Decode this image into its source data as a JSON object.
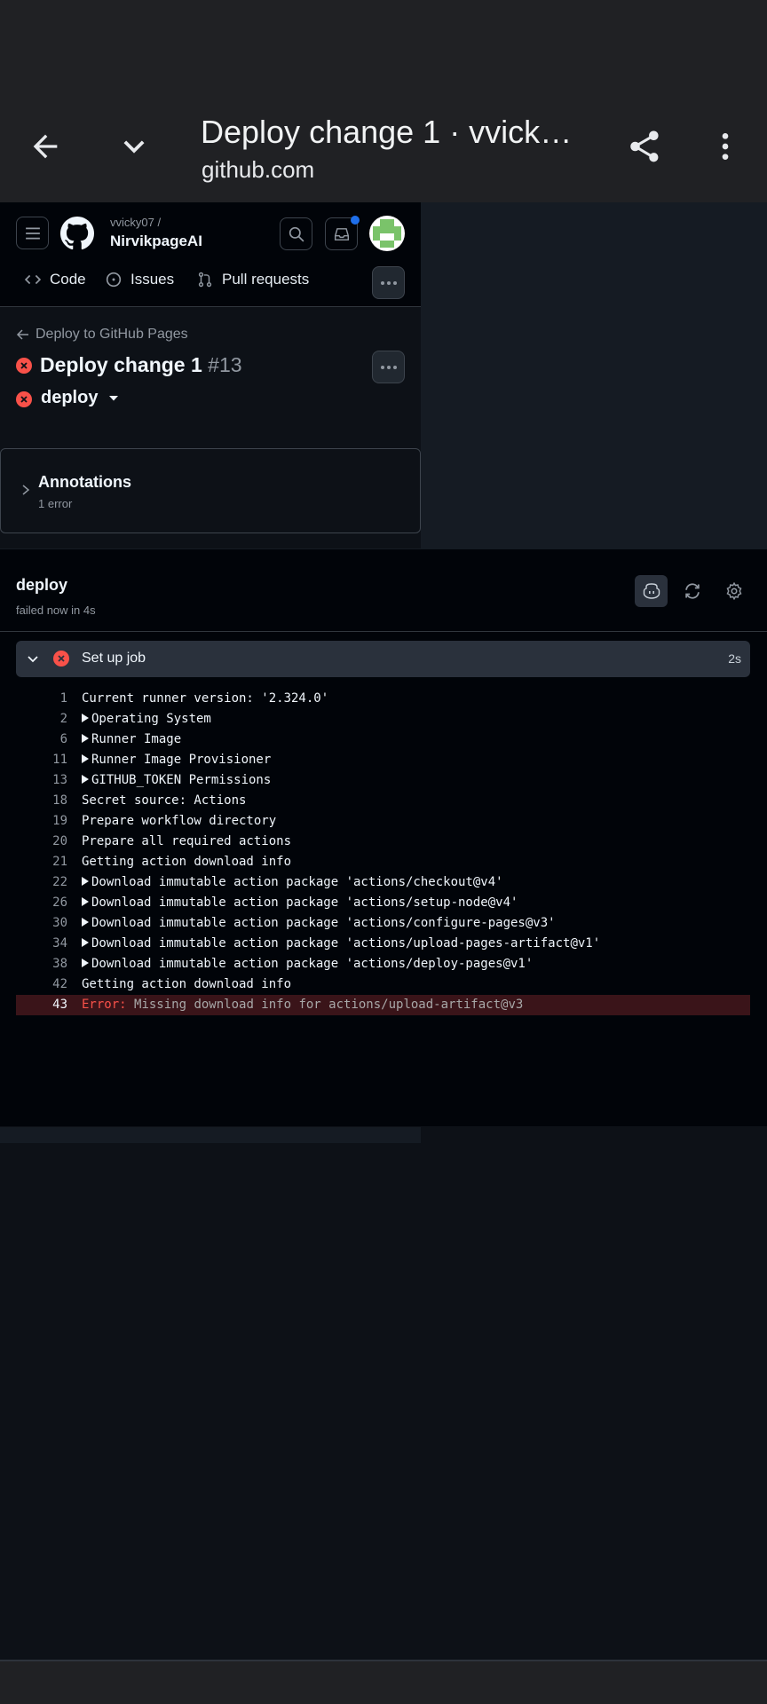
{
  "browser": {
    "title": "Deploy change 1 · vvicky07...",
    "url": "github.com"
  },
  "repo": {
    "owner": "vvicky07 /",
    "name": "NirvikpageAI"
  },
  "nav": {
    "tabs": [
      {
        "label": "Code",
        "icon": "code-icon"
      },
      {
        "label": "Issues",
        "icon": "issue-opened-icon"
      },
      {
        "label": "Pull requests",
        "icon": "git-pull-request-icon"
      }
    ]
  },
  "run": {
    "back_link": "Deploy to GitHub Pages",
    "title": "Deploy change 1",
    "number": "#13",
    "job_select": "deploy"
  },
  "annotations": {
    "title": "Annotations",
    "subtitle": "1 error"
  },
  "job": {
    "name": "deploy",
    "status": "failed now in 4s"
  },
  "step": {
    "name": "Set up job",
    "duration": "2s"
  },
  "log": [
    {
      "n": "1",
      "text": "Current runner version: '2.324.0'",
      "group": false
    },
    {
      "n": "2",
      "text": "Operating System",
      "group": true
    },
    {
      "n": "6",
      "text": "Runner Image",
      "group": true
    },
    {
      "n": "11",
      "text": "Runner Image Provisioner",
      "group": true
    },
    {
      "n": "13",
      "text": "GITHUB_TOKEN Permissions",
      "group": true
    },
    {
      "n": "18",
      "text": "Secret source: Actions",
      "group": false
    },
    {
      "n": "19",
      "text": "Prepare workflow directory",
      "group": false
    },
    {
      "n": "20",
      "text": "Prepare all required actions",
      "group": false
    },
    {
      "n": "21",
      "text": "Getting action download info",
      "group": false
    },
    {
      "n": "22",
      "text": "Download immutable action package 'actions/checkout@v4'",
      "group": true
    },
    {
      "n": "26",
      "text": "Download immutable action package 'actions/setup-node@v4'",
      "group": true
    },
    {
      "n": "30",
      "text": "Download immutable action package 'actions/configure-pages@v3'",
      "group": true
    },
    {
      "n": "34",
      "text": "Download immutable action package 'actions/upload-pages-artifact@v1'",
      "group": true
    },
    {
      "n": "38",
      "text": "Download immutable action package 'actions/deploy-pages@v1'",
      "group": true
    },
    {
      "n": "42",
      "text": "Getting action download info",
      "group": false
    }
  ],
  "error_line": {
    "n": "43",
    "label": "Error:",
    "message": "Missing download info for actions/upload-artifact@v3"
  },
  "colors": {
    "failure": "#f85149",
    "accent": "#1f6feb"
  }
}
